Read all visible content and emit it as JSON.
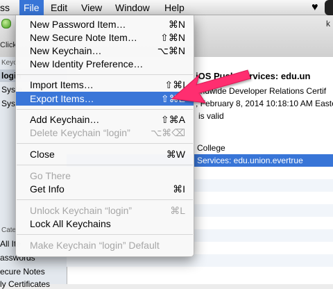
{
  "menubar": {
    "partial_app": "ss",
    "items": [
      "File",
      "Edit",
      "View",
      "Window",
      "Help"
    ]
  },
  "window": {
    "toolbar_click": "Click",
    "toolbar_right": "k",
    "sidebar": {
      "keychains_header": "Keych",
      "items": [
        "login",
        "Syste",
        "Syste"
      ],
      "category_header": "Cate",
      "categories": [
        "All Ite",
        "asswords",
        "ecure Notes",
        "ly Certificates"
      ]
    },
    "cert": {
      "title": "iOS Push Services: edu.un",
      "issuer": "orldwide Developer Relations Certif",
      "expires": ", February 8, 2014 10:18:10 AM Easte",
      "valid": "is valid"
    },
    "table": {
      "rows": [
        "College",
        "Services: edu.union.evertrue"
      ]
    }
  },
  "file_menu": {
    "items": [
      {
        "label": "New Password Item…",
        "shortcut": "⌘N",
        "enabled": true
      },
      {
        "label": "New Secure Note Item…",
        "shortcut": "⇧⌘N",
        "enabled": true
      },
      {
        "label": "New Keychain…",
        "shortcut": "⌥⌘N",
        "enabled": true
      },
      {
        "label": "New Identity Preference…",
        "shortcut": "",
        "enabled": true
      },
      {
        "label": "Import Items…",
        "shortcut": "⇧⌘I",
        "enabled": true
      },
      {
        "label": "Export Items…",
        "shortcut": "⇧⌘E",
        "enabled": true,
        "highlighted": true
      },
      {
        "label": "Add Keychain…",
        "shortcut": "⇧⌘A",
        "enabled": true
      },
      {
        "label": "Delete Keychain “login”",
        "shortcut": "⌥⌘⌫",
        "enabled": false
      },
      {
        "label": "Close",
        "shortcut": "⌘W",
        "enabled": true
      },
      {
        "label": "Go There",
        "shortcut": "",
        "enabled": false
      },
      {
        "label": "Get Info",
        "shortcut": "⌘I",
        "enabled": true
      },
      {
        "label": "Unlock Keychain “login”",
        "shortcut": "⌘L",
        "enabled": false
      },
      {
        "label": "Lock All Keychains",
        "shortcut": "",
        "enabled": true
      },
      {
        "label": "Make Keychain “login” Default",
        "shortcut": "",
        "enabled": false
      }
    ]
  },
  "colors": {
    "highlight": "#3a76d8",
    "arrow": "#ff2d6f",
    "disabled_text": "#a6a6a6"
  }
}
